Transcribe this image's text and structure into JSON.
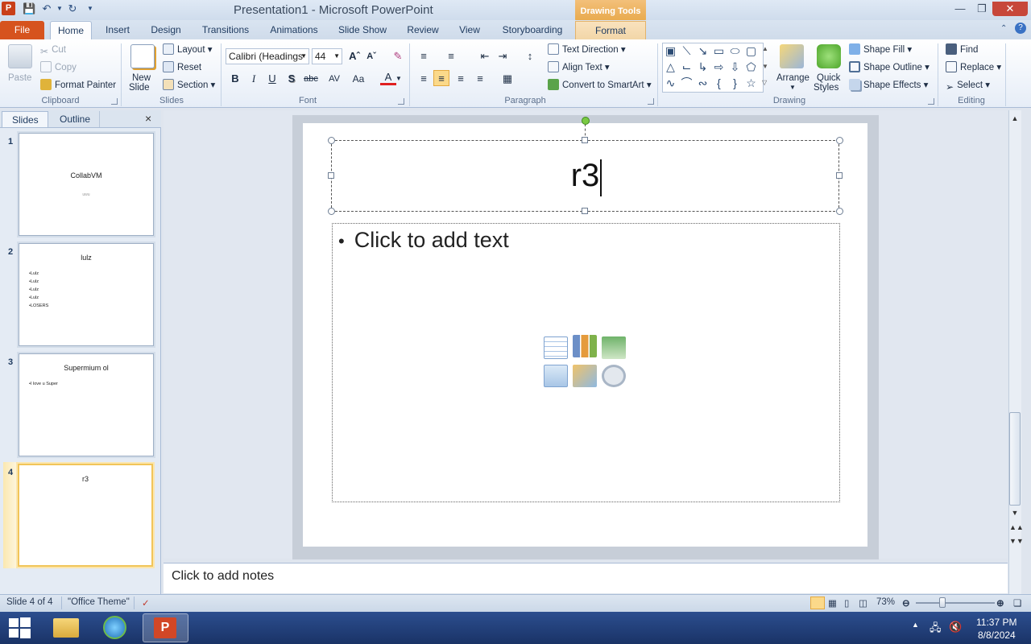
{
  "window": {
    "title": "Presentation1 - Microsoft PowerPoint",
    "contextual_header": "Drawing Tools",
    "app_icon": "P"
  },
  "tabs": [
    "File",
    "Home",
    "Insert",
    "Design",
    "Transitions",
    "Animations",
    "Slide Show",
    "Review",
    "View",
    "Storyboarding",
    "Format"
  ],
  "ribbon": {
    "clipboard": {
      "paste": "Paste",
      "cut": "Cut",
      "copy": "Copy",
      "format_painter": "Format Painter",
      "label": "Clipboard"
    },
    "slides": {
      "new_slide_1": "New",
      "new_slide_2": "Slide",
      "layout": "Layout",
      "reset": "Reset",
      "section": "Section",
      "label": "Slides"
    },
    "font": {
      "name": "Calibri (Headings",
      "size": "44",
      "label": "Font",
      "bold": "B",
      "italic": "I",
      "underline": "U",
      "shadow": "S",
      "strike": "abc",
      "spacing": "AV",
      "case": "Aa",
      "color": "A"
    },
    "paragraph": {
      "text_direction": "Text Direction",
      "align_text": "Align Text",
      "convert": "Convert to SmartArt",
      "label": "Paragraph"
    },
    "drawing": {
      "arrange": "Arrange",
      "quick_styles_1": "Quick",
      "quick_styles_2": "Styles",
      "shape_fill": "Shape Fill",
      "shape_outline": "Shape Outline",
      "shape_effects": "Shape Effects",
      "label": "Drawing"
    },
    "editing": {
      "find": "Find",
      "replace": "Replace",
      "select": "Select",
      "label": "Editing"
    }
  },
  "pane": {
    "tab_slides": "Slides",
    "tab_outline": "Outline",
    "close": "×"
  },
  "thumbnails": [
    {
      "num": "1",
      "title": "CollabVM",
      "subtitle": "uwu"
    },
    {
      "num": "2",
      "title": "lulz",
      "bullets": [
        "Lulz",
        "Lulz",
        "Lulz",
        "Lulz",
        "LOSERS"
      ]
    },
    {
      "num": "3",
      "title": "Supermium ol",
      "bullets": [
        "I love u Super"
      ]
    },
    {
      "num": "4",
      "title": "r3"
    }
  ],
  "slide": {
    "title": "r3",
    "content_placeholder": "Click to add text"
  },
  "notes": {
    "placeholder": "Click to add notes"
  },
  "status": {
    "slide_info": "Slide 4 of 4",
    "theme": "\"Office Theme\"",
    "zoom": "73%"
  },
  "taskbar": {
    "time": "11:37 PM",
    "date": "8/8/2024"
  },
  "colors": {
    "file_tab": "#d6531e",
    "contextual": "#e8a94b",
    "accent": "#2b579a",
    "taskbar": "#1f3d78"
  }
}
